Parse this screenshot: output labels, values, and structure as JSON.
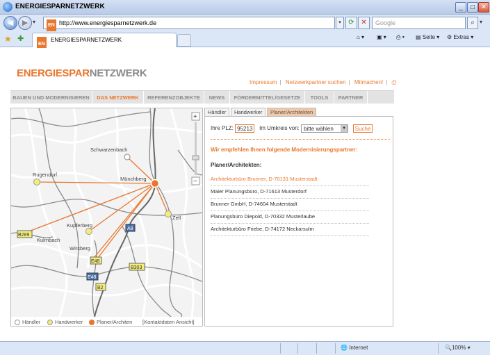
{
  "window": {
    "title": "ENERGIESPARNETZWERK"
  },
  "address": {
    "url": "http://www.energiesparnetzwerk.de",
    "search_placeholder": "Google"
  },
  "tab": {
    "label": "ENERGIESPARNETZWERK",
    "favicon": "EN"
  },
  "toolbar": {
    "page_label": "Seite",
    "extras_label": "Extras"
  },
  "site": {
    "logo_part1": "ENERGIESPAR",
    "logo_part2": "NETZWERK",
    "top_links": [
      "Impressum",
      "Netzwerkpartner suchen",
      "Mitmachen!"
    ],
    "nav": [
      "BAUEN UND MODERNISIEREN",
      "DAS NETZWERK",
      "REFERENZOBJEKTE",
      "NEWS",
      "FÖRDERMITTEL/GESETZE",
      "TOOLS",
      "PARTNER"
    ],
    "nav_active": "DAS NETZWERK"
  },
  "map": {
    "places": [
      "Schwarzenbach",
      "Rugendorf",
      "Münchberg",
      "Zell",
      "Kupferberg",
      "Kulmbach",
      "Wirsberg"
    ],
    "road_labels": [
      "A9",
      "B289",
      "E48",
      "B303",
      "E48",
      "B2"
    ],
    "legend": [
      "Händler",
      "Handwerker",
      "Planer/Architen",
      "[Kontaktdaten Ansicht]"
    ],
    "zoom_plus": "+",
    "zoom_minus": "−"
  },
  "panel": {
    "tabs": [
      "Händler",
      "Handwerker",
      "Planer/Architekten"
    ],
    "plz_label": "Ihre PLZ:",
    "plz_value": "95213",
    "radius_label": "Im Umkreis von:",
    "radius_value": "bitte wählen",
    "search_label": "Suche",
    "recommend_text": "Wir empfehlen Ihnen folgende Modernisierungspartner:",
    "section_title": "Planer/Architekten:",
    "partners": [
      "Architekturbüro Brunner, D-70131 Musterstadt",
      "Maier Planungsbüro, D-71613 Musterdorf",
      "Brunner GmbH, D-74604 Musterstadt",
      "Planungsbüro Diepold, D-70332 Musterlaube",
      "Architekturbüro Friebe, D-74172 Neckarsulm"
    ]
  },
  "status": {
    "zone": "Internet",
    "zoom": "100%"
  },
  "colors": {
    "accent": "#e8772e",
    "yellow_marker": "#f3ee7a",
    "road_label_blue": "#4c72a8"
  }
}
